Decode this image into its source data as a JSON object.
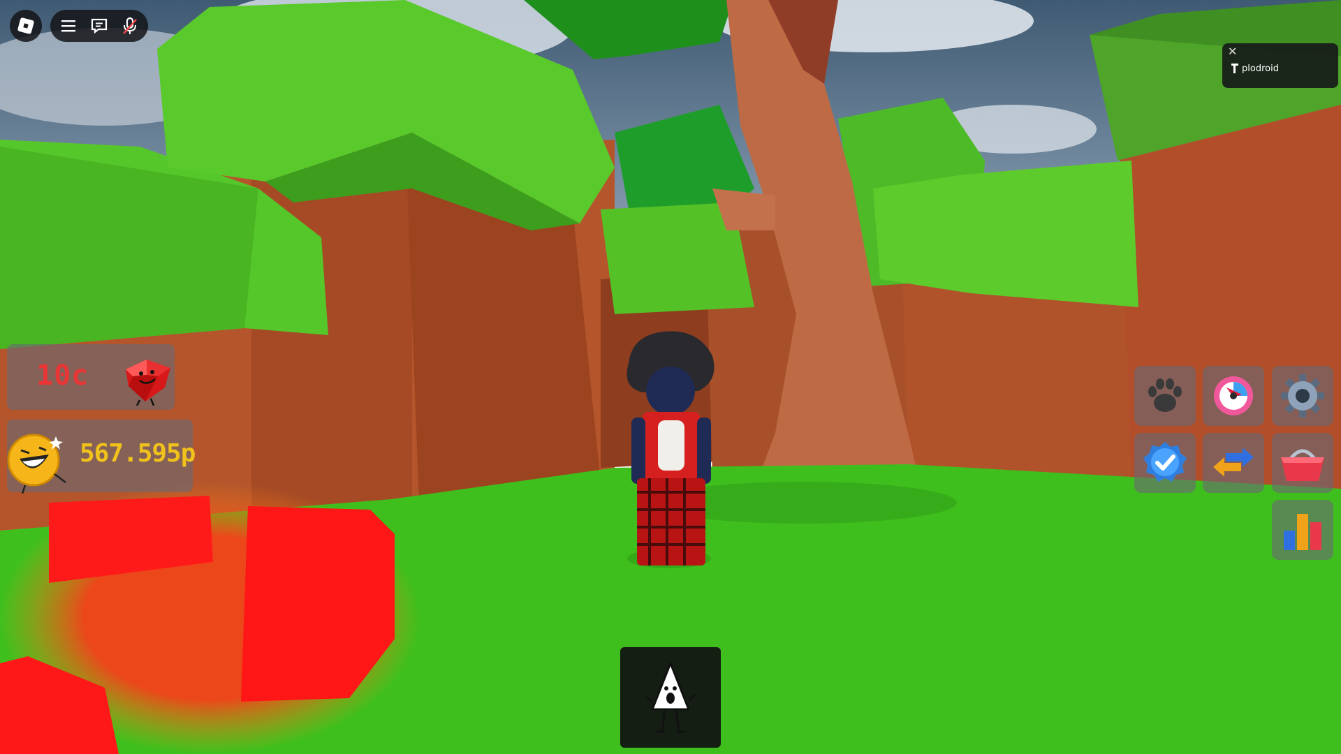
{
  "topbar": {
    "menu_icon": "hamburger-icon",
    "chat_icon": "chat-icon",
    "voice_icon": "microphone-icon",
    "logo_icon": "roblox-logo-icon"
  },
  "player_card": {
    "username": "plodroid",
    "close_icon": "close-icon",
    "status_icon": "voice-status-icon"
  },
  "stats": {
    "gems": "10c",
    "points": "567.595p"
  },
  "side_menu": [
    {
      "name": "pets",
      "icon": "paw-icon"
    },
    {
      "name": "spin",
      "icon": "spin-wheel-icon"
    },
    {
      "name": "settings",
      "icon": "gear-icon"
    },
    {
      "name": "verified",
      "icon": "verified-badge-icon"
    },
    {
      "name": "trade",
      "icon": "trade-arrows-icon"
    },
    {
      "name": "shop",
      "icon": "shop-basket-icon"
    },
    {
      "name": "leaderboard",
      "icon": "bar-chart-icon"
    }
  ],
  "hotbar": {
    "slot_1": "character-tool-icon"
  },
  "colors": {
    "gem_text": "#e83434",
    "point_text": "#f1c21b",
    "grass": "#3fbf1d",
    "canyon": "#b0552a"
  }
}
